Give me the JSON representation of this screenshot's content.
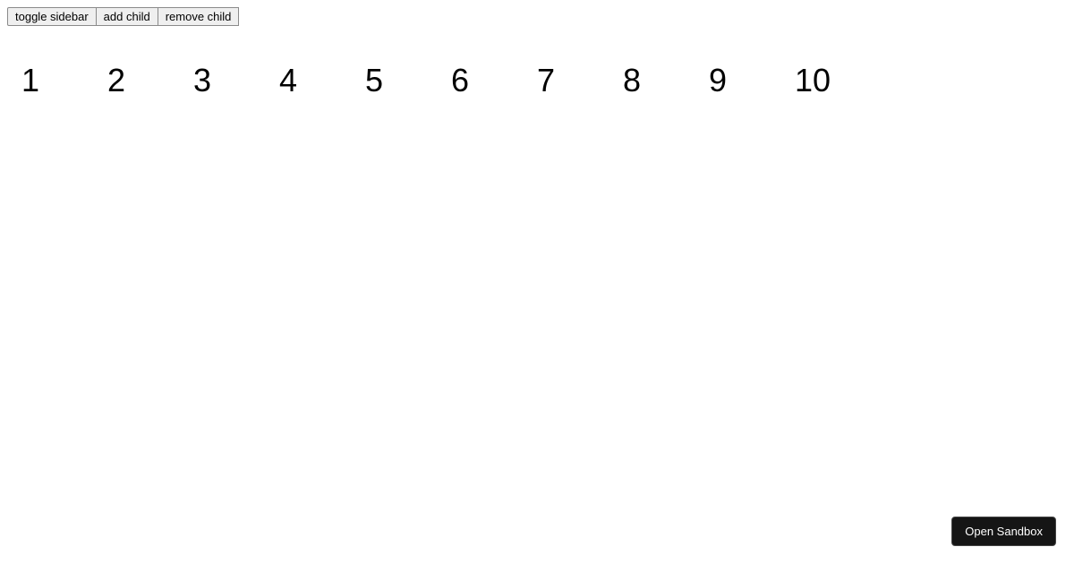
{
  "toolbar": {
    "toggle_sidebar_label": "toggle sidebar",
    "add_child_label": "add child",
    "remove_child_label": "remove child"
  },
  "items": [
    "1",
    "2",
    "3",
    "4",
    "5",
    "6",
    "7",
    "8",
    "9",
    "10"
  ],
  "footer": {
    "open_sandbox_label": "Open Sandbox"
  }
}
